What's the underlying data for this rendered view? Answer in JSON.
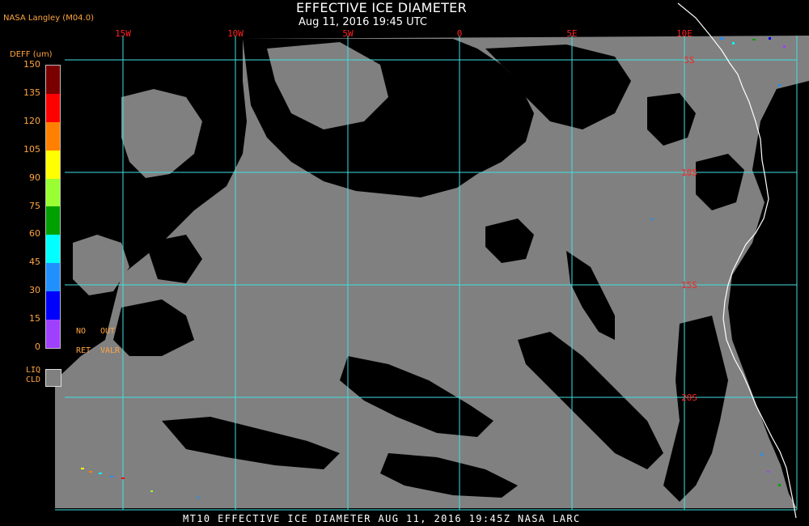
{
  "header": {
    "credit": "NASA Langley (M04.0)",
    "title": "EFFECTIVE ICE DIAMETER",
    "subtitle": "Aug 11, 2016 19:45 UTC"
  },
  "footer": {
    "caption": "MT10  EFFECTIVE ICE DIAMETER  AUG 11, 2016 19:45Z  NASA LARC"
  },
  "legend": {
    "title": "DEFF (um)",
    "ticks": [
      "150",
      "135",
      "120",
      "105",
      "90",
      "75",
      "60",
      "45",
      "30",
      "15",
      "0"
    ],
    "colors": [
      "#7a0000",
      "#ff0000",
      "#ff8000",
      "#ffff00",
      "#99ff33",
      "#00a000",
      "#00ffff",
      "#2090ff",
      "#0000ff",
      "#a040ff"
    ],
    "no_ret_1": "NO",
    "no_ret_2": "RET",
    "out_valr_1": "OUT",
    "out_valr_2": "VALR",
    "liq_1": "LIQ",
    "liq_2": "CLD",
    "liq_color": "#808080"
  },
  "map": {
    "longitude_labels": [
      "15W",
      "10W",
      "5W",
      "0",
      "5E",
      "10E"
    ],
    "latitude_labels": [
      "5S",
      "10S",
      "15S",
      "20S"
    ],
    "grid_color": "#40e0e0",
    "label_color": "#ff2020",
    "cloud_color": "#808080",
    "coast_color": "#ffffff"
  }
}
